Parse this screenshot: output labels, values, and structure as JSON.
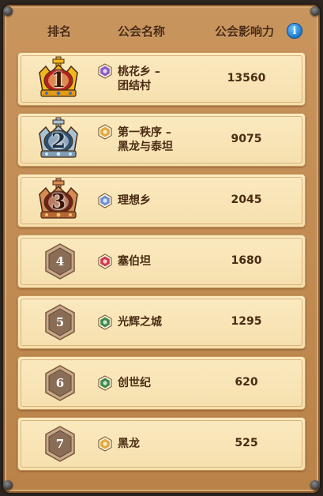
{
  "header": {
    "rank_label": "排名",
    "name_label": "公会名称",
    "influence_label": "公会影响力",
    "info_icon": "i"
  },
  "rows": [
    {
      "rank": "1",
      "badge": "gold-crown",
      "name_line1": "桃花乡 –",
      "name_line2": "团结村",
      "influence": "13560",
      "emblem_color": "#8a5ac8"
    },
    {
      "rank": "2",
      "badge": "silver-crown",
      "name_line1": "第一秩序 –",
      "name_line2": "黑龙与泰坦",
      "influence": "9075",
      "emblem_color": "#e2a93a"
    },
    {
      "rank": "3",
      "badge": "bronze-crown",
      "name_line1": "理想乡",
      "name_line2": "",
      "influence": "2045",
      "emblem_color": "#6f8fd8"
    },
    {
      "rank": "4",
      "badge": "hexagon",
      "name_line1": "塞伯坦",
      "name_line2": "",
      "influence": "1680",
      "emblem_color": "#d03a4a"
    },
    {
      "rank": "5",
      "badge": "hexagon",
      "name_line1": "光辉之城",
      "name_line2": "",
      "influence": "1295",
      "emblem_color": "#3d8a4a"
    },
    {
      "rank": "6",
      "badge": "hexagon",
      "name_line1": "创世纪",
      "name_line2": "",
      "influence": "620",
      "emblem_color": "#3d8a4a"
    },
    {
      "rank": "7",
      "badge": "hexagon",
      "name_line1": "黑龙",
      "name_line2": "",
      "influence": "525",
      "emblem_color": "#e2a93a"
    }
  ]
}
